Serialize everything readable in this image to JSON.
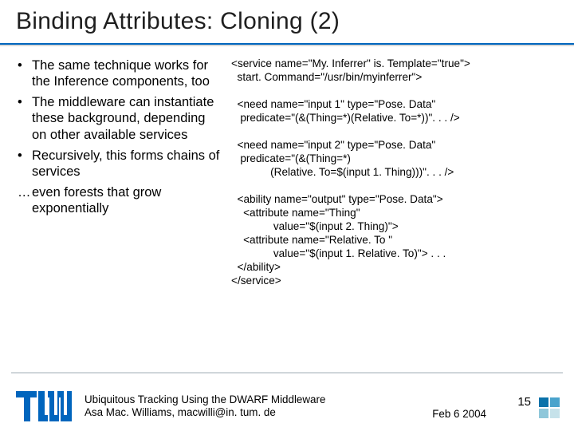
{
  "title": "Binding Attributes: Cloning (2)",
  "bullets": {
    "mark": "•",
    "ellips": "…",
    "b1": " The same technique works for the Inference components, too",
    "b2": " The middleware can instantiate these background, depending on other available services",
    "b3": " Recursively, this forms chains of services",
    "b4": " even forests that grow exponentially"
  },
  "code": {
    "l1": "<service name=\"My. Inferrer\" is. Template=\"true\">",
    "l2": "  start. Command=\"/usr/bin/myinferrer\">",
    "blank": " ",
    "l3": "  <need name=\"input 1\" type=\"Pose. Data\"",
    "l4": "   predicate=\"(&(Thing=*)(Relative. To=*))\". . . />",
    "l5": "  <need name=\"input 2\" type=\"Pose. Data\"",
    "l6": "   predicate=\"(&(Thing=*)",
    "l7": "             (Relative. To=$(input 1. Thing)))\". . . />",
    "l8": "  <ability name=\"output\" type=\"Pose. Data\">",
    "l9": "    <attribute name=\"Thing\"",
    "l10": "              value=\"$(input 2. Thing)\">",
    "l11": "    <attribute name=\"Relative. To \"",
    "l12": "              value=\"$(input 1. Relative. To)\"> . . .",
    "l13": "  </ability>",
    "l14": "</service>"
  },
  "footer": {
    "line1": "Ubiquitous Tracking Using the DWARF Middleware",
    "line2": "Asa Mac. Williams, macwilli@in. tum. de",
    "date": "Feb 6 2004",
    "page": "15"
  },
  "icons": {
    "logo_color": "#0065BD",
    "corner_colors": [
      "#0a72aa",
      "#4aa3cc",
      "#8fc7da",
      "#c6e2ea"
    ]
  }
}
